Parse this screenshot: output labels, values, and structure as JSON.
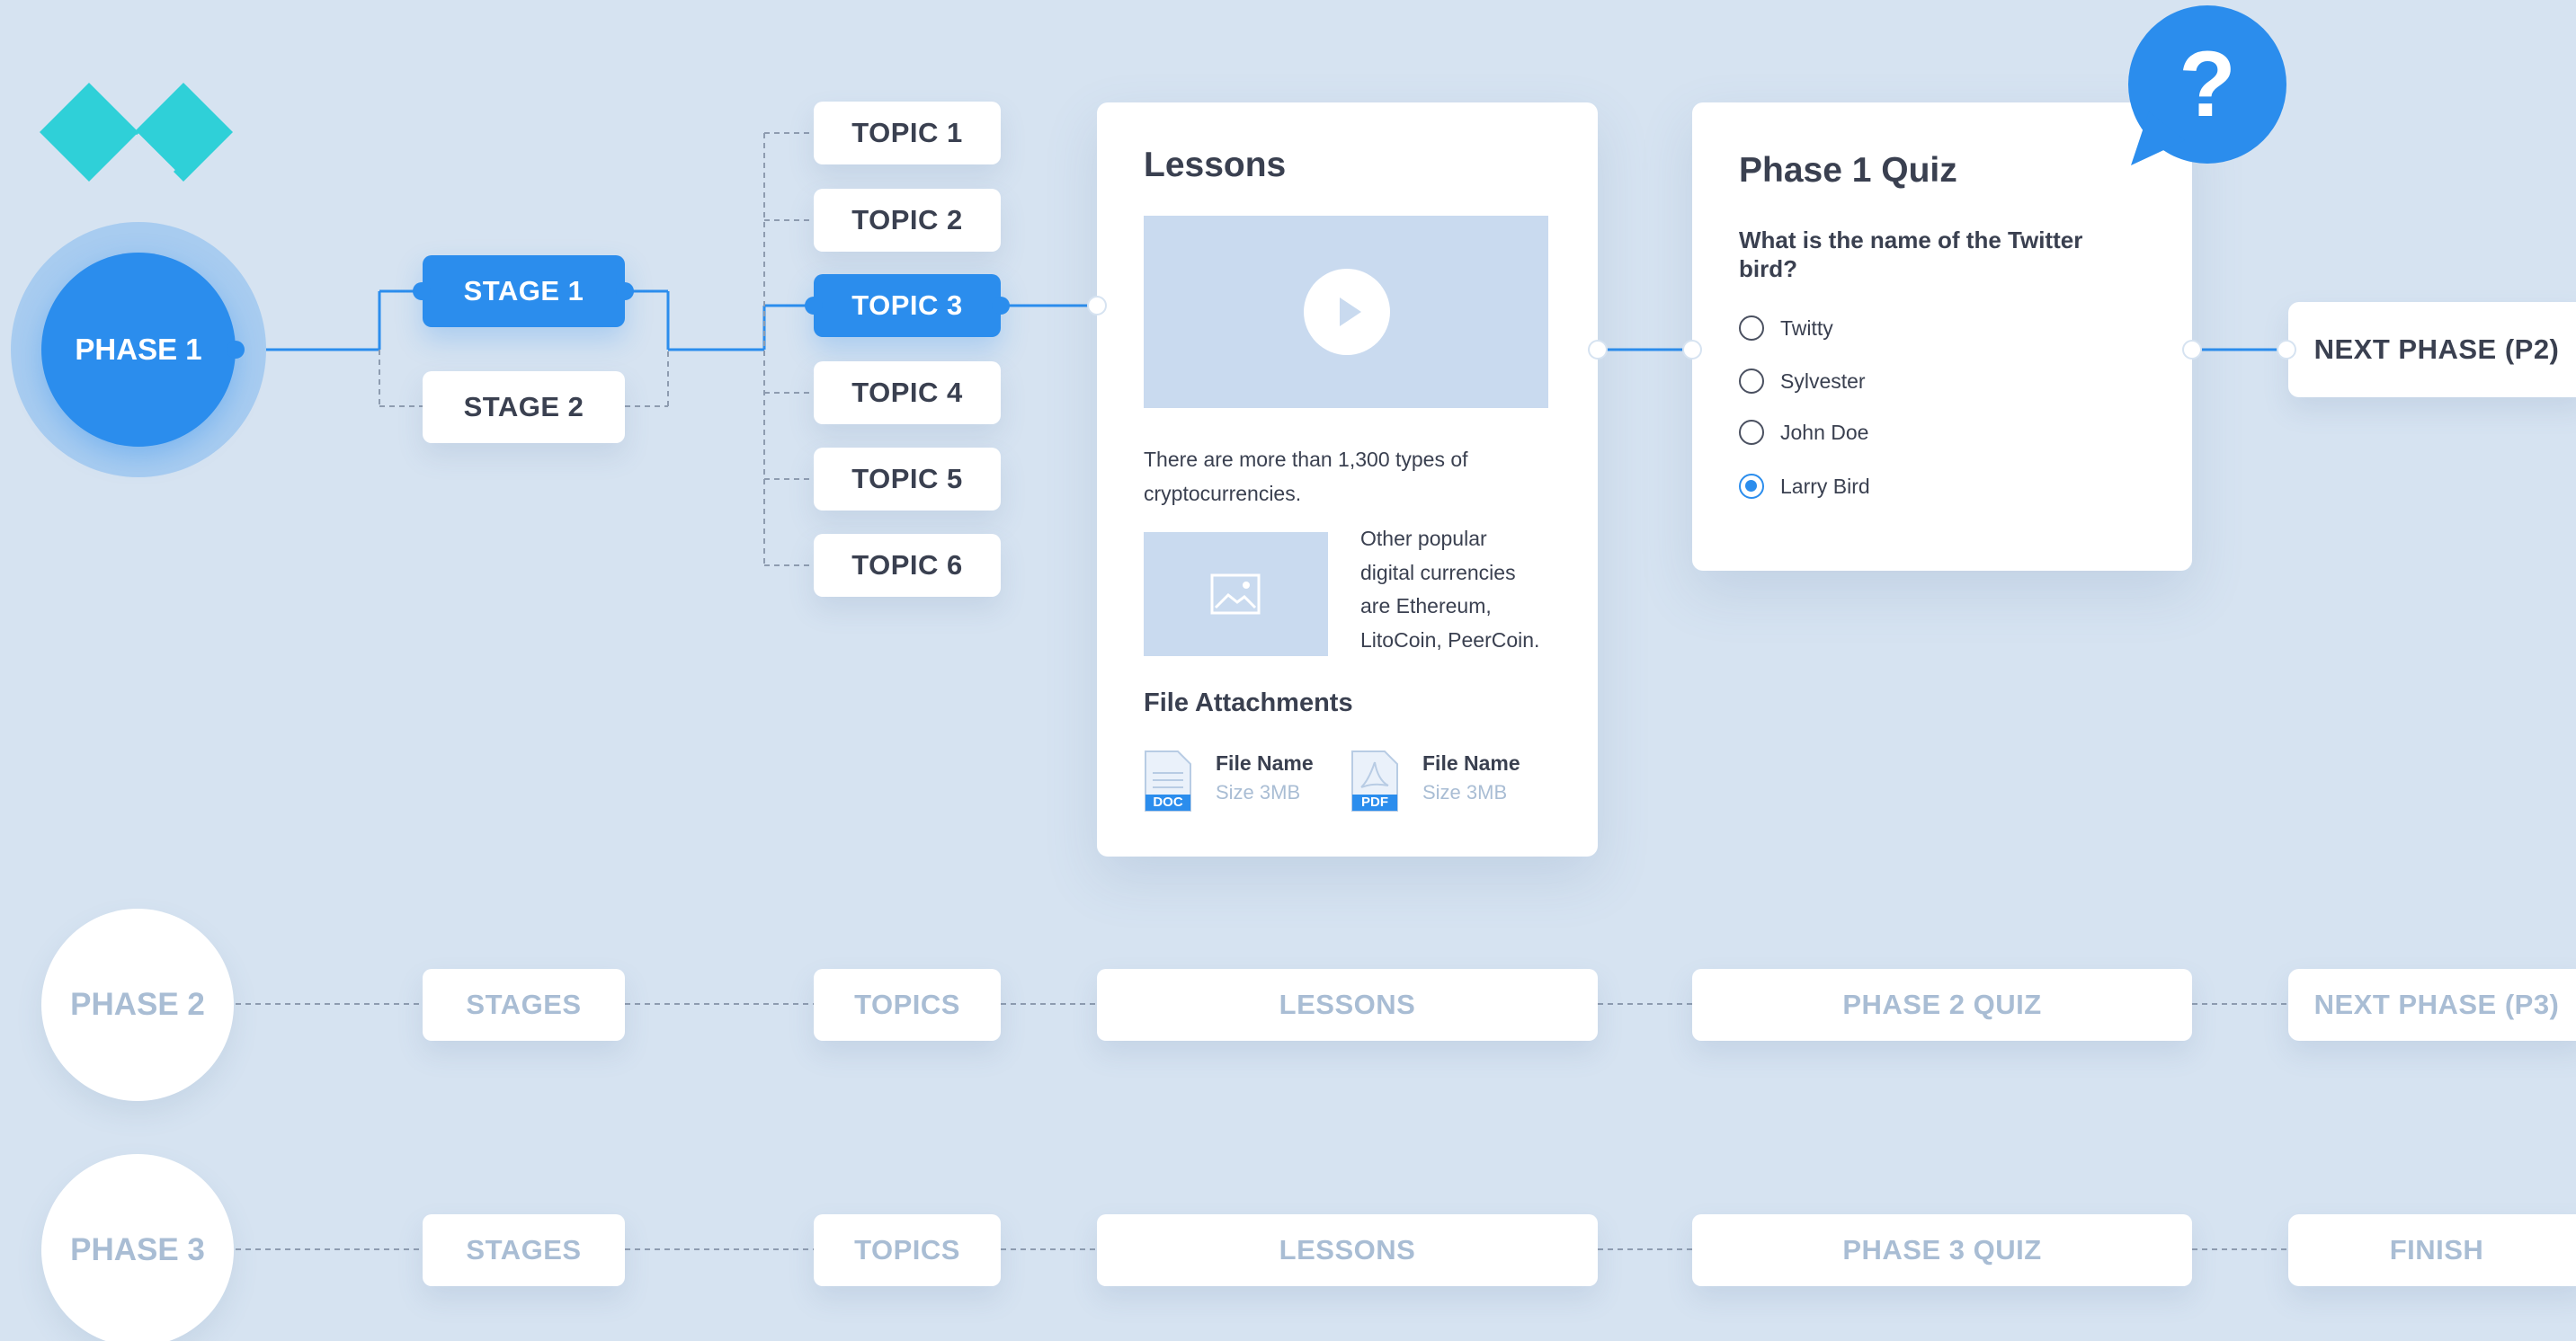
{
  "phase1": {
    "label": "PHASE 1",
    "stages": [
      "STAGE 1",
      "STAGE 2"
    ],
    "topics": [
      "TOPIC 1",
      "TOPIC 2",
      "TOPIC 3",
      "TOPIC 4",
      "TOPIC 5",
      "TOPIC 6"
    ],
    "active_stage": "STAGE 1",
    "active_topic": "TOPIC 3"
  },
  "lessons": {
    "title": "Lessons",
    "paragraph_line1": "There are more than 1,300 types of",
    "paragraph_line2": "cryptocurrencies.",
    "side_text": [
      "Other popular",
      "digital currencies",
      "are Ethereum,",
      "LitoCoin, PeerCoin."
    ],
    "attachments_title": "File Attachments",
    "files": [
      {
        "type": "DOC",
        "name": "File Name",
        "size": "Size 3MB"
      },
      {
        "type": "PDF",
        "name": "File Name",
        "size": "Size 3MB"
      }
    ]
  },
  "quiz": {
    "title": "Phase 1 Quiz",
    "question_line1": "What is the name of the Twitter",
    "question_line2": "bird?",
    "options": [
      "Twitty",
      "Sylvester",
      "John Doe",
      "Larry Bird"
    ],
    "selected": "Larry Bird",
    "bubble": "?"
  },
  "next1": "NEXT PHASE (P2)",
  "phase2": {
    "label": "PHASE 2",
    "stages": "STAGES",
    "topics": "TOPICS",
    "lessons": "LESSONS",
    "quiz": "PHASE 2 QUIZ",
    "next": "NEXT PHASE (P3)"
  },
  "phase3": {
    "label": "PHASE 3",
    "stages": "STAGES",
    "topics": "TOPICS",
    "lessons": "LESSONS",
    "quiz": "PHASE 3 QUIZ",
    "next": "FINISH"
  },
  "colors": {
    "background": "#d6e3f1",
    "accent": "#2b8ded",
    "logo": "#2fd0d8",
    "ghost_text": "#a9bdd4",
    "text": "#3a4050"
  }
}
